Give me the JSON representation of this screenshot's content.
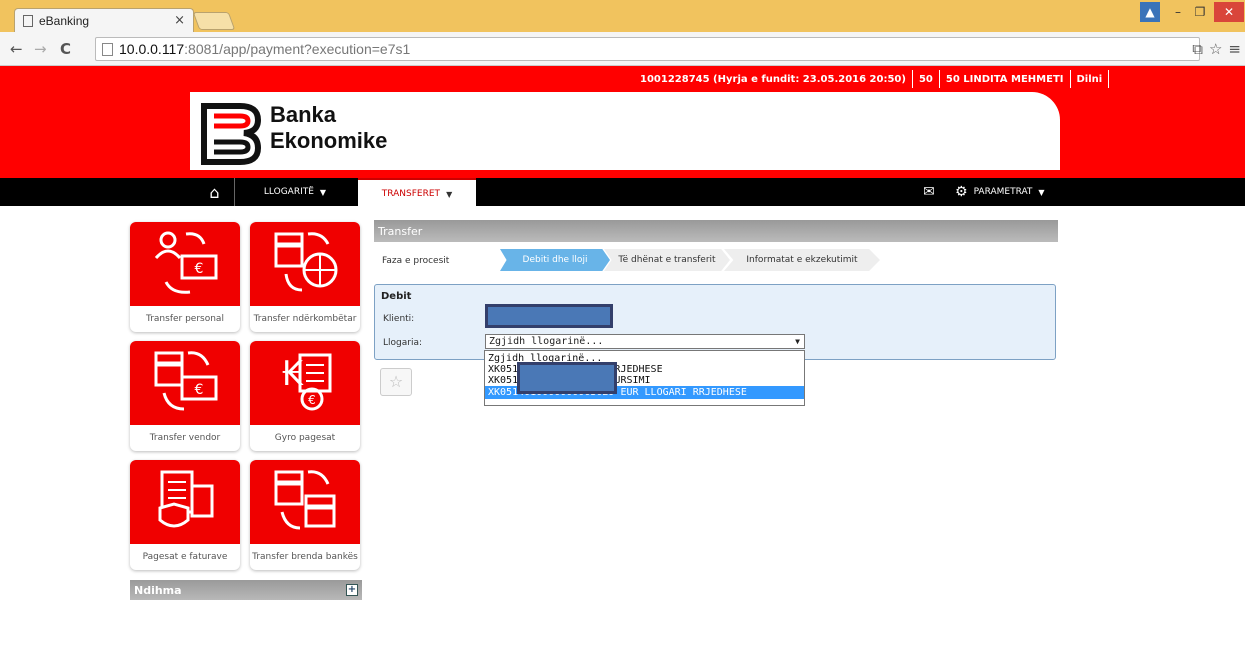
{
  "browser": {
    "tab_title": "eBanking",
    "tab_close": "×",
    "url_host": "10.0.0.117",
    "url_rest": ":8081/app/payment?execution=e7s1"
  },
  "header": {
    "account_info": "1001228745 (Hyrja e fundit: 23.05.2016 20:50)",
    "counter": "50",
    "user": "50 LINDITA MEHMETI",
    "logout": "Dilni",
    "brand_line1": "Banka",
    "brand_line2": "Ekonomike",
    "brand_color": "#ff0000"
  },
  "nav": {
    "home_icon": "home-icon",
    "accounts": "LLOGARITË",
    "transfers": "TRANSFERET",
    "mail_icon": "mail-icon",
    "params": "PARAMETRAT"
  },
  "tiles": [
    {
      "label": "Transfer personal",
      "icon": "personal-transfer-icon"
    },
    {
      "label": "Transfer ndërkombëtar",
      "icon": "international-transfer-icon"
    },
    {
      "label": "Transfer vendor",
      "icon": "domestic-transfer-icon"
    },
    {
      "label": "Gyro pagesat",
      "icon": "giro-payment-icon"
    },
    {
      "label": "Pagesat e faturave",
      "icon": "bill-payment-icon"
    },
    {
      "label": "Transfer brenda bankës",
      "icon": "internal-transfer-icon"
    }
  ],
  "help": {
    "label": "Ndihma",
    "plus": "+"
  },
  "transfer": {
    "title": "Transfer",
    "phase_label": "Faza e procesit",
    "steps": [
      "Debiti dhe lloji",
      "Të dhënat e transferit",
      "Informatat e ekzekutimit"
    ],
    "debit_title": "Debit",
    "client_label": "Klienti:",
    "account_label": "Llogaria:",
    "select_value": "Zgjidh llogarinë...",
    "options": [
      "Zgjidh llogarinë...",
      "XK051                  9 DEM LLOGARI RRJEDHESE",
      "XK051                  9 EUR LLOGARI KURSIMI",
      "XK0514010000000003029 EUR LLOGARI RRJEDHESE"
    ]
  }
}
